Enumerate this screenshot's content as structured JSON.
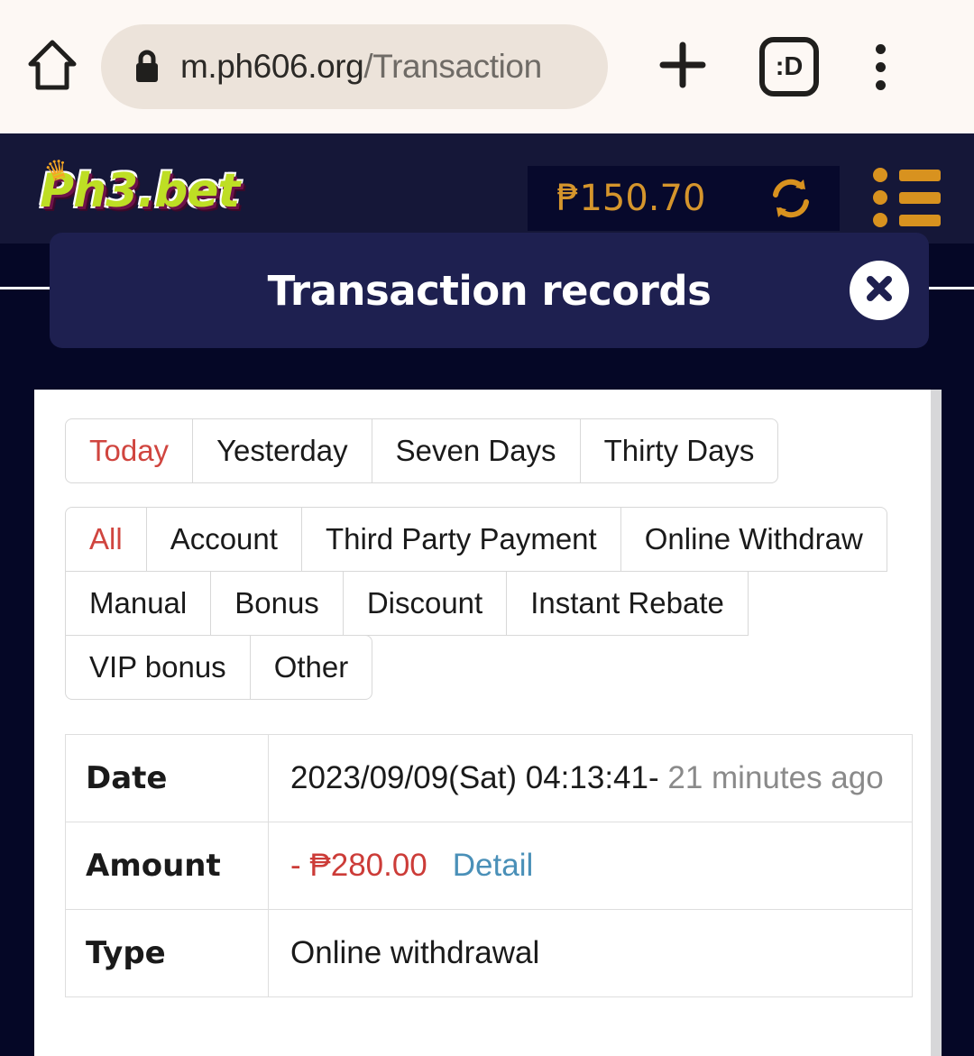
{
  "browser": {
    "home_icon": "home-icon",
    "lock_icon": "lock-icon",
    "url_host": "m.ph606.org",
    "url_path": "/Transaction",
    "new_tab_icon": "plus-icon",
    "tab_count_label": ":D",
    "menu_icon": "kebab-menu-icon"
  },
  "site_header": {
    "logo_text": "Ph3.bet",
    "logo_crown_icon": "crown-icon",
    "balance": "₱150.70",
    "refresh_icon": "refresh-icon",
    "menu_icon": "list-menu-icon"
  },
  "modal": {
    "title": "Transaction records",
    "close_icon": "close-icon"
  },
  "filters": {
    "date_ranges": [
      {
        "label": "Today",
        "active": true
      },
      {
        "label": "Yesterday",
        "active": false
      },
      {
        "label": "Seven Days",
        "active": false
      },
      {
        "label": "Thirty Days",
        "active": false
      }
    ],
    "types_row1": [
      {
        "label": "All",
        "active": true
      },
      {
        "label": "Account",
        "active": false
      },
      {
        "label": "Third Party Payment",
        "active": false
      },
      {
        "label": "Online Withdraw",
        "active": false
      }
    ],
    "types_row2": [
      {
        "label": "Manual",
        "active": false
      },
      {
        "label": "Bonus",
        "active": false
      },
      {
        "label": "Discount",
        "active": false
      },
      {
        "label": "Instant Rebate",
        "active": false
      }
    ],
    "types_row3": [
      {
        "label": "VIP bonus",
        "active": false
      },
      {
        "label": "Other",
        "active": false
      }
    ]
  },
  "record": {
    "date_label": "Date",
    "date_value": "2023/09/09(Sat) 04:13:41",
    "date_separator": "-",
    "date_relative": "21 minutes ago",
    "amount_label": "Amount",
    "amount_value": "- ₱280.00",
    "detail_link": "Detail",
    "type_label": "Type",
    "type_value": "Online withdrawal"
  },
  "colors": {
    "page_background": "#050726",
    "header_background": "#151738",
    "modal_background": "#1e2050",
    "accent_orange": "#d8921f",
    "active_red": "#d0453f",
    "amount_negative": "#cc3c38",
    "link_blue": "#4a90b8",
    "logo_green": "#bede24"
  }
}
